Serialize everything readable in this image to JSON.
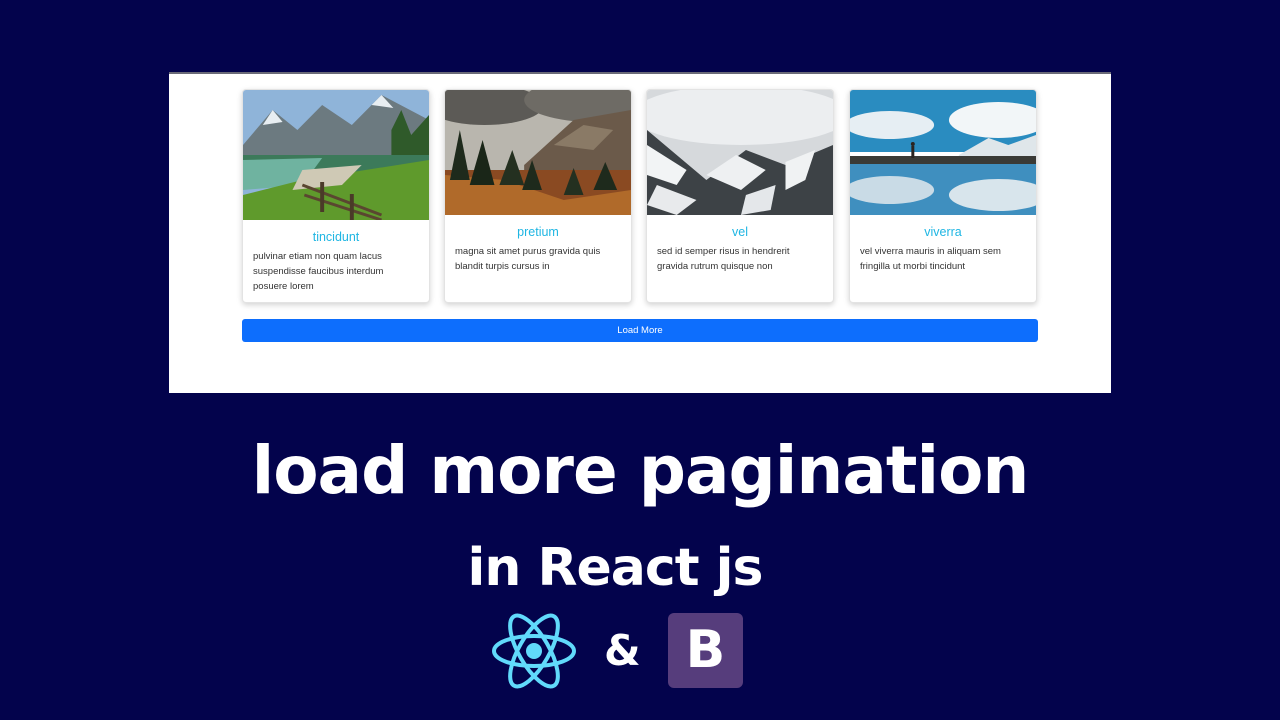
{
  "cards": [
    {
      "title": "tincidunt",
      "body": "pulvinar etiam non quam lacus suspendisse faucibus interdum posuere lorem"
    },
    {
      "title": "pretium",
      "body": "magna sit amet purus gravida quis blandit turpis cursus in"
    },
    {
      "title": "vel",
      "body": "sed id semper risus in hendrerit gravida rutrum quisque non"
    },
    {
      "title": "viverra",
      "body": "vel viverra mauris in aliquam sem fringilla ut morbi tincidunt"
    }
  ],
  "load_more_label": "Load More",
  "headline": "load more pagination",
  "subhead": "in React js",
  "ampersand": "&",
  "bootstrap_letter": "B",
  "colors": {
    "background": "#03034c",
    "accent": "#0d6efd",
    "card_title": "#1fb6e3",
    "react": "#61dafb",
    "bootstrap": "#563d7c"
  }
}
